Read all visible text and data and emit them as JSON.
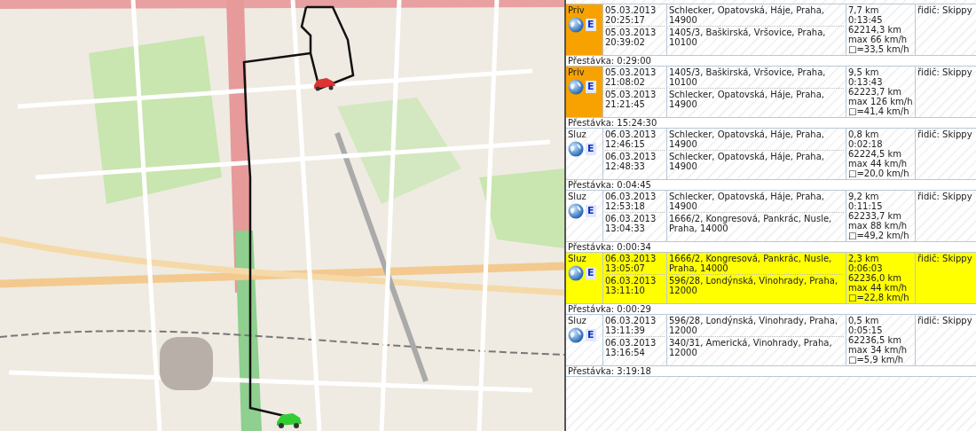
{
  "trips": [
    {
      "kind": "priv",
      "type": "Priv",
      "badge": "E",
      "highlighted": false,
      "start_time": "05.03.2013 20:25:17",
      "start_address": "Schlecker, Opatovská, Háje, Praha, 14900",
      "end_time": "05.03.2013 20:39:02",
      "end_address": "1405/3, Baškirská, Vršovice, Praha, 10100",
      "stats": [
        "7,7 km",
        "0:13:45",
        "62214,3 km",
        "max 66 km/h",
        "□=33,5 km/h"
      ],
      "driver": "řidič: Skippy",
      "pause_after": "Přestávka: 0:29:00"
    },
    {
      "kind": "priv",
      "type": "Priv",
      "badge": "E",
      "highlighted": false,
      "start_time": "05.03.2013 21:08:02",
      "start_address": "1405/3, Baškirská, Vršovice, Praha, 10100",
      "end_time": "05.03.2013 21:21:45",
      "end_address": "Schlecker, Opatovská, Háje, Praha, 14900",
      "stats": [
        "9,5 km",
        "0:13:43",
        "62223,7 km",
        "max 126 km/h",
        "□=41,4 km/h"
      ],
      "driver": "řidič: Skippy",
      "pause_after": "Přestávka: 15:24:30"
    },
    {
      "kind": "sluz",
      "type": "Sluz",
      "badge": "E",
      "highlighted": false,
      "start_time": "06.03.2013 12:46:15",
      "start_address": "Schlecker, Opatovská, Háje, Praha, 14900",
      "end_time": "06.03.2013 12:48:33",
      "end_address": "Schlecker, Opatovská, Háje, Praha, 14900",
      "stats": [
        "0,8 km",
        "0:02:18",
        "62224,5 km",
        "max 44 km/h",
        "□=20,0 km/h"
      ],
      "driver": "řidič: Skippy",
      "pause_after": "Přestávka: 0:04:45"
    },
    {
      "kind": "sluz",
      "type": "Sluz",
      "badge": "E",
      "highlighted": false,
      "start_time": "06.03.2013 12:53:18",
      "start_address": "Schlecker, Opatovská, Háje, Praha, 14900",
      "end_time": "06.03.2013 13:04:33",
      "end_address": "1666/2, Kongresová, Pankrác, Nusle, Praha, 14000",
      "stats": [
        "9,2 km",
        "0:11:15",
        "62233,7 km",
        "max 88 km/h",
        "□=49,2 km/h"
      ],
      "driver": "řidič: Skippy",
      "pause_after": "Přestávka: 0:00:34"
    },
    {
      "kind": "sluz",
      "type": "Sluz",
      "badge": "E",
      "highlighted": true,
      "start_time": "06.03.2013 13:05:07",
      "start_address": "1666/2, Kongresová, Pankrác, Nusle, Praha, 14000",
      "end_time": "06.03.2013 13:11:10",
      "end_address": "596/28, Londýnská, Vinohrady, Praha, 12000",
      "stats": [
        "2,3 km",
        "0:06:03",
        "62236,0 km",
        "max 44 km/h",
        "□=22,8 km/h"
      ],
      "driver": "řidič: Skippy",
      "pause_after": "Přestávka: 0:00:29"
    },
    {
      "kind": "sluz",
      "type": "Sluz",
      "badge": "E",
      "highlighted": false,
      "start_time": "06.03.2013 13:11:39",
      "start_address": "596/28, Londýnská, Vinohrady, Praha, 12000",
      "end_time": "06.03.2013 13:16:54",
      "end_address": "340/31, Americká, Vinohrady, Praha, 12000",
      "stats": [
        "0,5 km",
        "0:05:15",
        "62236,5 km",
        "max 34 km/h",
        "□=5,9 km/h"
      ],
      "driver": "řidič: Skippy",
      "pause_after": "Přestávka: 3:19:18"
    }
  ]
}
